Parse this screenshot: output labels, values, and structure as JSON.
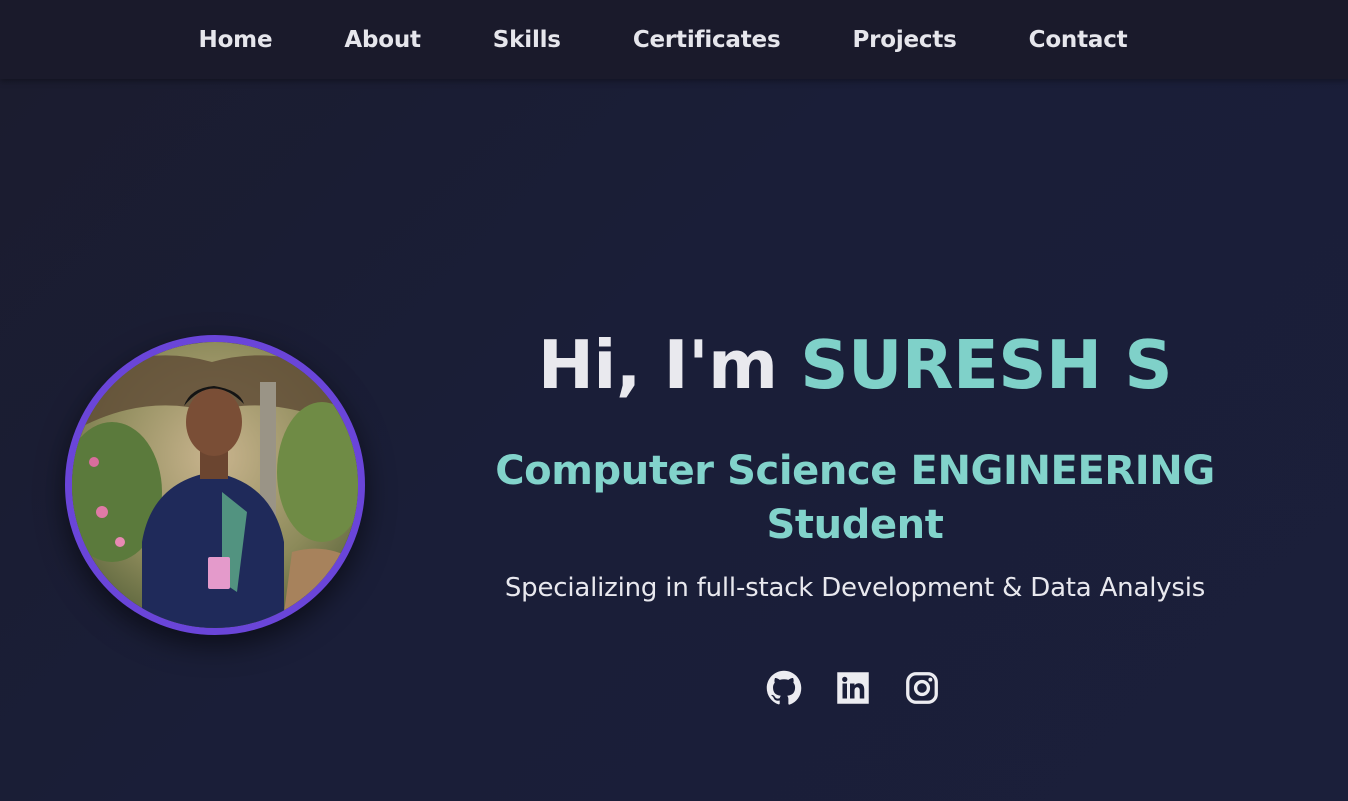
{
  "nav": {
    "items": [
      {
        "label": "Home"
      },
      {
        "label": "About"
      },
      {
        "label": "Skills"
      },
      {
        "label": "Certificates"
      },
      {
        "label": "Projects"
      },
      {
        "label": "Contact"
      }
    ]
  },
  "hero": {
    "greeting": "Hi, I'm ",
    "name": "SURESH S",
    "role": "Computer Science ENGINEERING Student",
    "tagline": "Specializing in full-stack Development & Data Analysis",
    "photo": {
      "border_color": "#6a45d9"
    }
  },
  "social": [
    {
      "icon": "github-icon"
    },
    {
      "icon": "linkedin-icon"
    },
    {
      "icon": "instagram-icon"
    }
  ],
  "colors": {
    "background": "#1a1e35",
    "navbar": "#1a1a2b",
    "accent": "#7fd1c9",
    "text": "#e8e8ee"
  }
}
